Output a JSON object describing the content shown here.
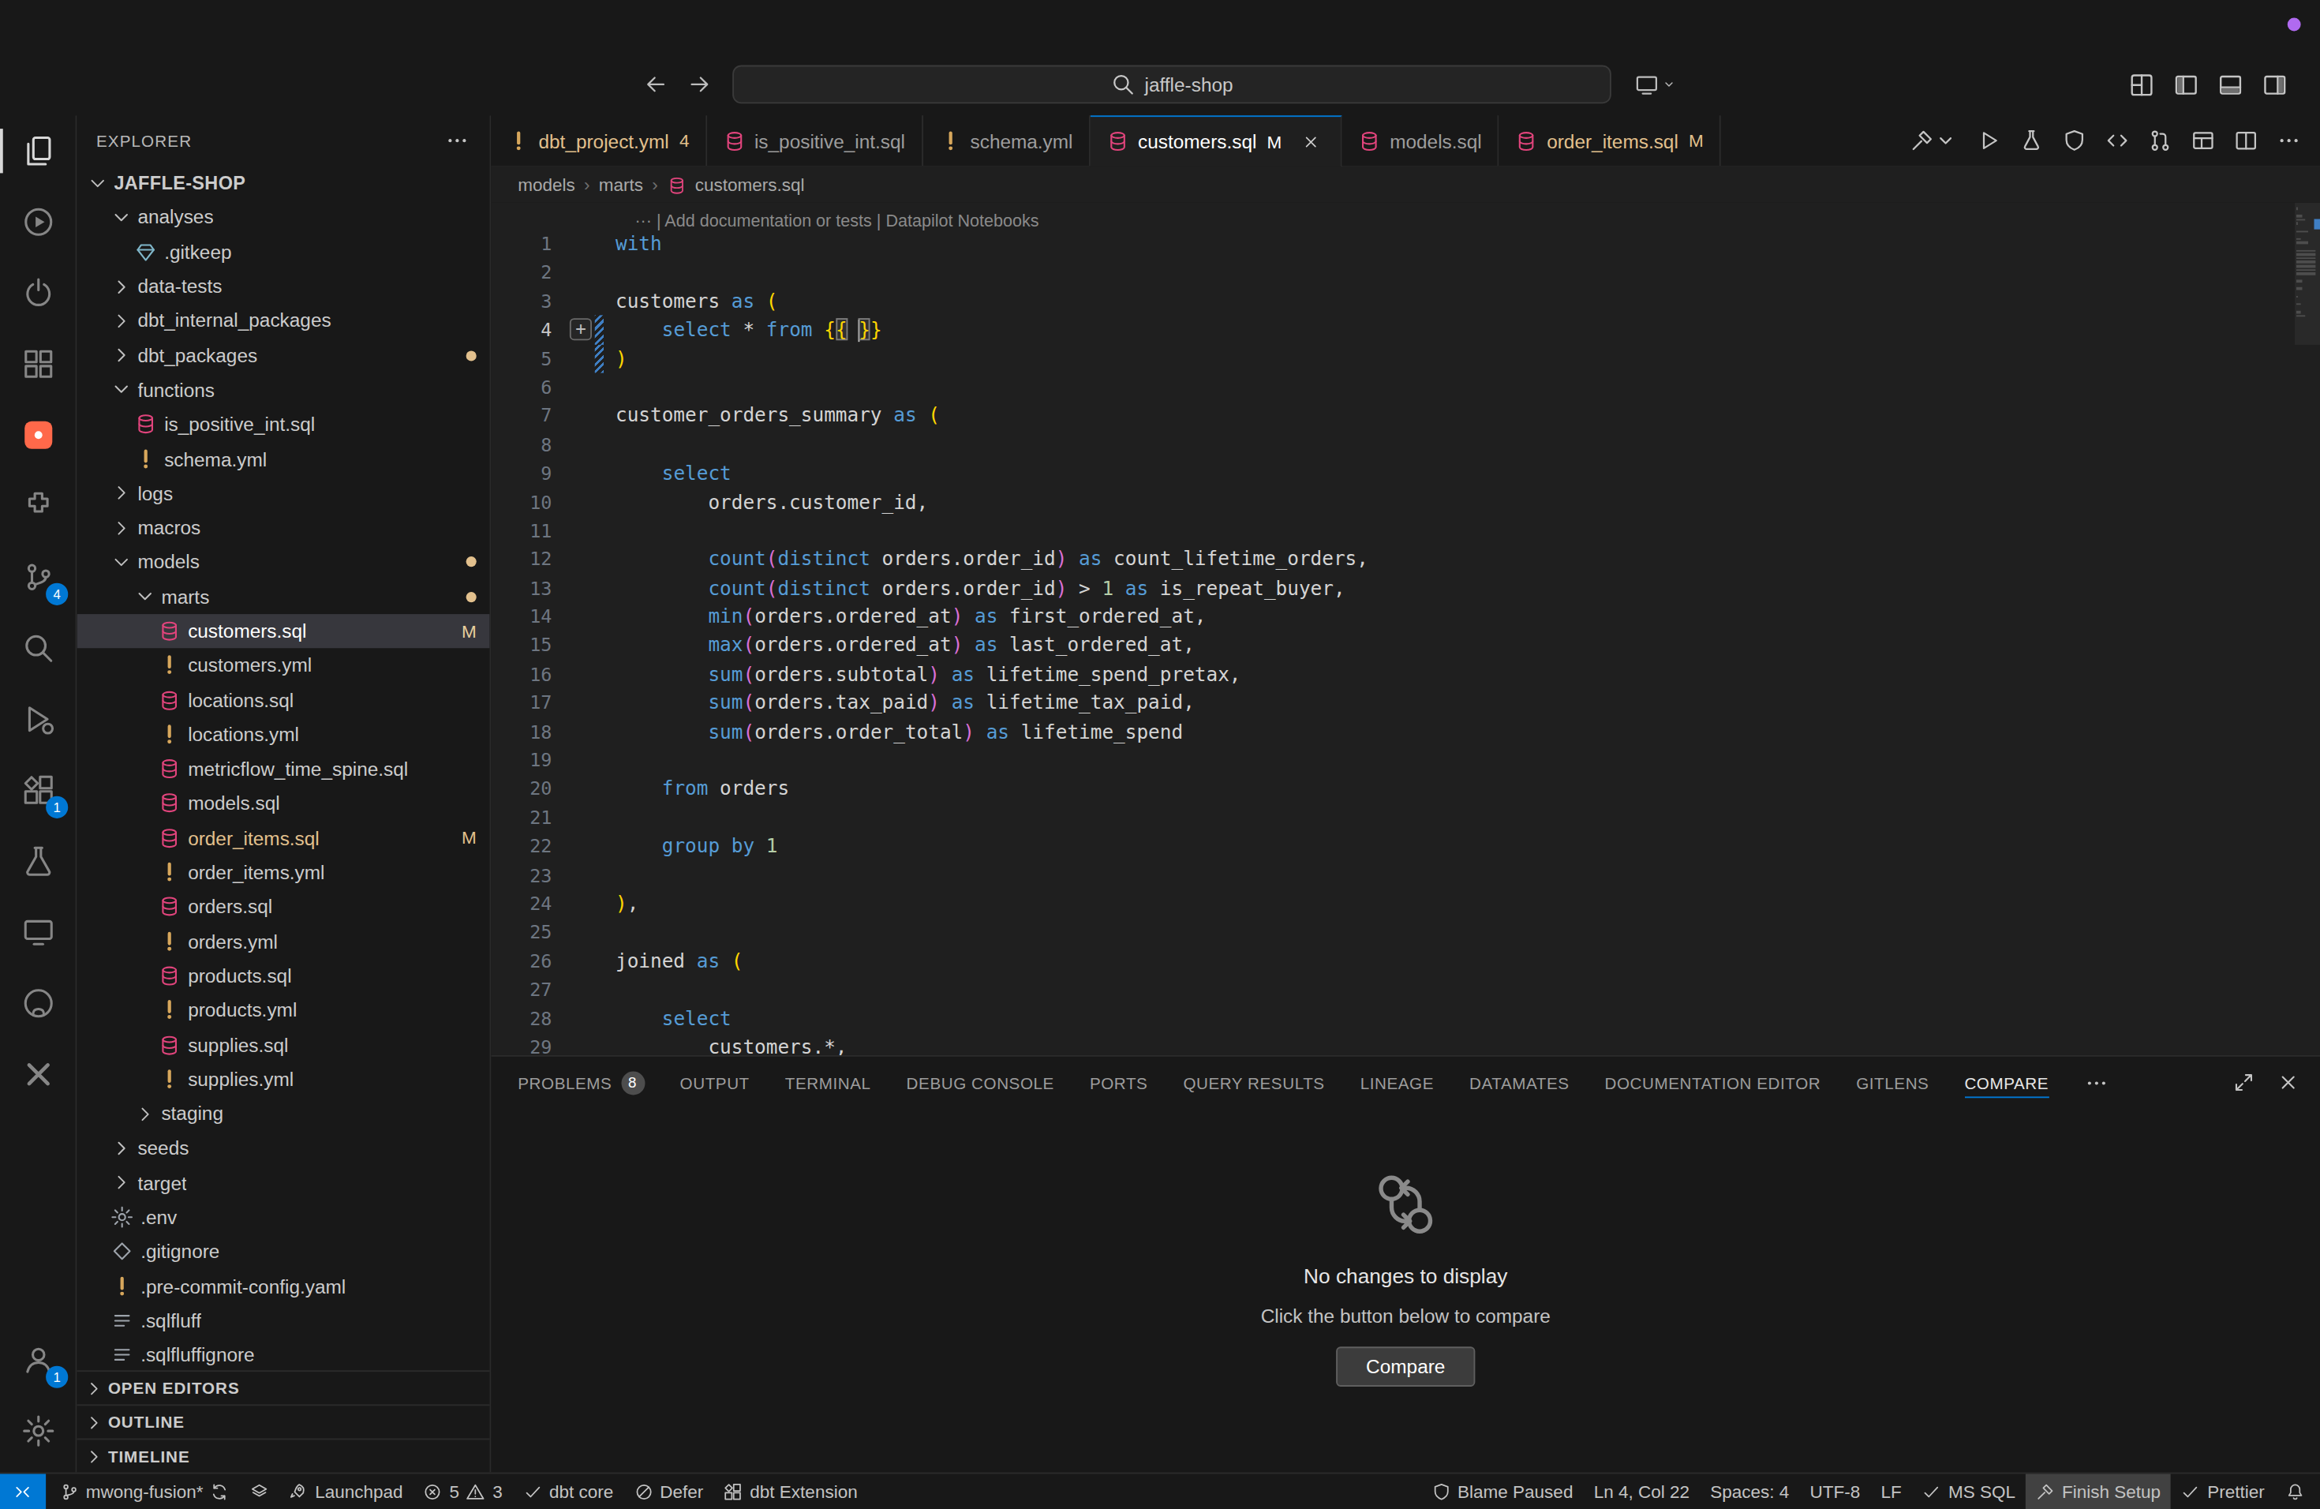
{
  "colors": {
    "accent": "#0078d4",
    "modified": "#e2c08d",
    "dbt_orange": "#ff694a",
    "sql_icon_pink": "#e1447c",
    "yaml_icon_yellow": "#d7a75c",
    "keyword_blue": "#569cd6",
    "bracket_gold": "#ffd700",
    "bracket_pink": "#da70d6",
    "title_indicator": "#b06af0"
  },
  "title_bar": {
    "search_text": "jaffle-shop",
    "nav": [
      {
        "name": "navigate-back",
        "icon": "arrow-left"
      },
      {
        "name": "navigate-forward",
        "icon": "arrow-right"
      }
    ],
    "cast": {
      "name": "screencast-control",
      "icon": "cast",
      "chevron": true
    },
    "actions": [
      {
        "name": "customize-layout",
        "icon": "layout-grid"
      },
      {
        "name": "toggle-primary-sidebar",
        "icon": "layout-left"
      },
      {
        "name": "toggle-panel",
        "icon": "layout-bottom"
      },
      {
        "name": "toggle-secondary-sidebar",
        "icon": "layout-right"
      }
    ]
  },
  "activity_bar": {
    "top": [
      {
        "name": "explorer",
        "icon": "files",
        "active": true
      },
      {
        "name": "run-sessions",
        "icon": "play-circle"
      },
      {
        "name": "power-tools",
        "icon": "power-circle"
      },
      {
        "name": "components",
        "icon": "blocks"
      },
      {
        "name": "dbt-power-user",
        "icon": "dbt"
      },
      {
        "name": "puzzle-extension",
        "icon": "puzzle"
      },
      {
        "name": "source-control",
        "icon": "source-control",
        "badge": "4"
      },
      {
        "name": "search",
        "icon": "search"
      },
      {
        "name": "run-and-debug",
        "icon": "debug"
      },
      {
        "name": "extensions",
        "icon": "extensions",
        "badge": "1"
      },
      {
        "name": "testing",
        "icon": "beaker"
      },
      {
        "name": "remote-explorer",
        "icon": "monitor"
      },
      {
        "name": "github",
        "icon": "github"
      },
      {
        "name": "close-tools",
        "icon": "x-tool"
      }
    ],
    "bottom": [
      {
        "name": "accounts",
        "icon": "account",
        "badge": "1"
      },
      {
        "name": "settings",
        "icon": "gear"
      }
    ]
  },
  "sidebar": {
    "title": "EXPLORER",
    "tree": [
      {
        "label": "JAFFLE-SHOP",
        "depth": 0,
        "chevron": "down",
        "root": true
      },
      {
        "label": "analyses",
        "depth": 1,
        "chevron": "down"
      },
      {
        "label": ".gitkeep",
        "depth": 2,
        "icon": "gem"
      },
      {
        "label": "data-tests",
        "depth": 1,
        "chevron": "right"
      },
      {
        "label": "dbt_internal_packages",
        "depth": 1,
        "chevron": "right"
      },
      {
        "label": "dbt_packages",
        "depth": 1,
        "chevron": "right",
        "dot": true
      },
      {
        "label": "functions",
        "depth": 1,
        "chevron": "down"
      },
      {
        "label": "is_positive_int.sql",
        "depth": 2,
        "icon": "sql"
      },
      {
        "label": "schema.yml",
        "depth": 2,
        "icon": "yaml"
      },
      {
        "label": "logs",
        "depth": 1,
        "chevron": "right"
      },
      {
        "label": "macros",
        "depth": 1,
        "chevron": "right"
      },
      {
        "label": "models",
        "depth": 1,
        "chevron": "down",
        "dot": true
      },
      {
        "label": "marts",
        "depth": 2,
        "chevron": "down",
        "dot": true
      },
      {
        "label": "customers.sql",
        "depth": 3,
        "icon": "sql",
        "badge": "M",
        "selected": true
      },
      {
        "label": "customers.yml",
        "depth": 3,
        "icon": "yaml"
      },
      {
        "label": "locations.sql",
        "depth": 3,
        "icon": "sql"
      },
      {
        "label": "locations.yml",
        "depth": 3,
        "icon": "yaml"
      },
      {
        "label": "metricflow_time_spine.sql",
        "depth": 3,
        "icon": "sql"
      },
      {
        "label": "models.sql",
        "depth": 3,
        "icon": "sql"
      },
      {
        "label": "order_items.sql",
        "depth": 3,
        "icon": "sql",
        "badge": "M",
        "modified": true
      },
      {
        "label": "order_items.yml",
        "depth": 3,
        "icon": "yaml"
      },
      {
        "label": "orders.sql",
        "depth": 3,
        "icon": "sql"
      },
      {
        "label": "orders.yml",
        "depth": 3,
        "icon": "yaml"
      },
      {
        "label": "products.sql",
        "depth": 3,
        "icon": "sql"
      },
      {
        "label": "products.yml",
        "depth": 3,
        "icon": "yaml"
      },
      {
        "label": "supplies.sql",
        "depth": 3,
        "icon": "sql"
      },
      {
        "label": "supplies.yml",
        "depth": 3,
        "icon": "yaml"
      },
      {
        "label": "staging",
        "depth": 2,
        "chevron": "right"
      },
      {
        "label": "seeds",
        "depth": 1,
        "chevron": "right"
      },
      {
        "label": "target",
        "depth": 1,
        "chevron": "right"
      },
      {
        "label": ".env",
        "depth": 1,
        "icon": "gear-file"
      },
      {
        "label": ".gitignore",
        "depth": 1,
        "icon": "diamond-file"
      },
      {
        "label": ".pre-commit-config.yaml",
        "depth": 1,
        "icon": "yaml"
      },
      {
        "label": ".sqlfluff",
        "depth": 1,
        "icon": "lines-file"
      },
      {
        "label": ".sqlfluffignore",
        "depth": 1,
        "icon": "lines-file"
      }
    ],
    "sections": [
      "OPEN EDITORS",
      "OUTLINE",
      "TIMELINE"
    ]
  },
  "editor": {
    "tabs": [
      {
        "label": "dbt_project.yml",
        "icon": "yaml",
        "badge": "4",
        "color": "#e2c08d"
      },
      {
        "label": "is_positive_int.sql",
        "icon": "sql"
      },
      {
        "label": "schema.yml",
        "icon": "yaml"
      },
      {
        "label": "customers.sql",
        "icon": "sql",
        "suffix": "M",
        "active": true
      },
      {
        "label": "models.sql",
        "icon": "sql"
      },
      {
        "label": "order_items.sql",
        "icon": "sql",
        "suffix": "M",
        "color": "#e2c08d"
      }
    ],
    "actions": [
      {
        "name": "dbt-build",
        "icon": "hammer",
        "chevron": true
      },
      {
        "name": "run-file",
        "icon": "play-outline"
      },
      {
        "name": "run-tests",
        "icon": "flask"
      },
      {
        "name": "security-scan",
        "icon": "shield-a"
      },
      {
        "name": "compiled-code",
        "icon": "code"
      },
      {
        "name": "git-pull-request",
        "icon": "pr"
      },
      {
        "name": "query-results-grid",
        "icon": "table"
      },
      {
        "name": "split-editor",
        "icon": "split"
      },
      {
        "name": "more-actions",
        "icon": "ellipsis"
      }
    ],
    "breadcrumb": [
      "models",
      "marts",
      "customers.sql"
    ],
    "codelens": "··· | Add documentation or tests | Datapilot Notebooks",
    "cursor": {
      "line": 4,
      "col": 22
    },
    "lines": [
      {
        "n": 1,
        "tokens": [
          [
            "k",
            "with"
          ]
        ]
      },
      {
        "n": 2,
        "tokens": []
      },
      {
        "n": 3,
        "tokens": [
          [
            "t",
            "customers "
          ],
          [
            "k",
            "as"
          ],
          [
            "t",
            " "
          ],
          [
            "p1",
            "("
          ]
        ]
      },
      {
        "n": 4,
        "active": true,
        "changed": true,
        "plus": true,
        "tokens": [
          [
            "t",
            "    "
          ],
          [
            "k",
            "select"
          ],
          [
            "t",
            " * "
          ],
          [
            "k",
            "from"
          ],
          [
            "t",
            " "
          ],
          [
            "p1",
            "{"
          ],
          [
            "p2m",
            "{"
          ],
          [
            "t",
            " "
          ],
          [
            "cursor",
            ""
          ],
          [
            "p2m",
            "}"
          ],
          [
            "p1",
            "}"
          ]
        ]
      },
      {
        "n": 5,
        "changed": true,
        "tokens": [
          [
            "p1",
            ")"
          ]
        ]
      },
      {
        "n": 6,
        "tokens": []
      },
      {
        "n": 7,
        "tokens": [
          [
            "t",
            "customer_orders_summary "
          ],
          [
            "k",
            "as"
          ],
          [
            "t",
            " "
          ],
          [
            "p1",
            "("
          ]
        ]
      },
      {
        "n": 8,
        "tokens": []
      },
      {
        "n": 9,
        "tokens": [
          [
            "t",
            "    "
          ],
          [
            "k",
            "select"
          ]
        ]
      },
      {
        "n": 10,
        "tokens": [
          [
            "t",
            "        orders.customer_id,"
          ]
        ]
      },
      {
        "n": 11,
        "tokens": []
      },
      {
        "n": 12,
        "tokens": [
          [
            "t",
            "        "
          ],
          [
            "k",
            "count"
          ],
          [
            "p2",
            "("
          ],
          [
            "k",
            "distinct"
          ],
          [
            "t",
            " orders.order_id"
          ],
          [
            "p2",
            ")"
          ],
          [
            "t",
            " "
          ],
          [
            "k",
            "as"
          ],
          [
            "t",
            " count_lifetime_orders,"
          ]
        ]
      },
      {
        "n": 13,
        "tokens": [
          [
            "t",
            "        "
          ],
          [
            "k",
            "count"
          ],
          [
            "p2",
            "("
          ],
          [
            "k",
            "distinct"
          ],
          [
            "t",
            " orders.order_id"
          ],
          [
            "p2",
            ")"
          ],
          [
            "t",
            " > "
          ],
          [
            "n",
            "1"
          ],
          [
            "t",
            " "
          ],
          [
            "k",
            "as"
          ],
          [
            "t",
            " is_repeat_buyer,"
          ]
        ]
      },
      {
        "n": 14,
        "tokens": [
          [
            "t",
            "        "
          ],
          [
            "k",
            "min"
          ],
          [
            "p2",
            "("
          ],
          [
            "t",
            "orders.ordered_at"
          ],
          [
            "p2",
            ")"
          ],
          [
            "t",
            " "
          ],
          [
            "k",
            "as"
          ],
          [
            "t",
            " first_ordered_at,"
          ]
        ]
      },
      {
        "n": 15,
        "tokens": [
          [
            "t",
            "        "
          ],
          [
            "k",
            "max"
          ],
          [
            "p2",
            "("
          ],
          [
            "t",
            "orders.ordered_at"
          ],
          [
            "p2",
            ")"
          ],
          [
            "t",
            " "
          ],
          [
            "k",
            "as"
          ],
          [
            "t",
            " last_ordered_at,"
          ]
        ]
      },
      {
        "n": 16,
        "tokens": [
          [
            "t",
            "        "
          ],
          [
            "k",
            "sum"
          ],
          [
            "p2",
            "("
          ],
          [
            "t",
            "orders.subtotal"
          ],
          [
            "p2",
            ")"
          ],
          [
            "t",
            " "
          ],
          [
            "k",
            "as"
          ],
          [
            "t",
            " lifetime_spend_pretax,"
          ]
        ]
      },
      {
        "n": 17,
        "tokens": [
          [
            "t",
            "        "
          ],
          [
            "k",
            "sum"
          ],
          [
            "p2",
            "("
          ],
          [
            "t",
            "orders.tax_paid"
          ],
          [
            "p2",
            ")"
          ],
          [
            "t",
            " "
          ],
          [
            "k",
            "as"
          ],
          [
            "t",
            " lifetime_tax_paid,"
          ]
        ]
      },
      {
        "n": 18,
        "tokens": [
          [
            "t",
            "        "
          ],
          [
            "k",
            "sum"
          ],
          [
            "p2",
            "("
          ],
          [
            "t",
            "orders.order_total"
          ],
          [
            "p2",
            ")"
          ],
          [
            "t",
            " "
          ],
          [
            "k",
            "as"
          ],
          [
            "t",
            " lifetime_spend"
          ]
        ]
      },
      {
        "n": 19,
        "tokens": []
      },
      {
        "n": 20,
        "tokens": [
          [
            "t",
            "    "
          ],
          [
            "k",
            "from"
          ],
          [
            "t",
            " orders"
          ]
        ]
      },
      {
        "n": 21,
        "tokens": []
      },
      {
        "n": 22,
        "tokens": [
          [
            "t",
            "    "
          ],
          [
            "k",
            "group by"
          ],
          [
            "t",
            " "
          ],
          [
            "n",
            "1"
          ]
        ]
      },
      {
        "n": 23,
        "tokens": []
      },
      {
        "n": 24,
        "tokens": [
          [
            "p1",
            ")"
          ],
          [
            "t",
            ","
          ]
        ]
      },
      {
        "n": 25,
        "tokens": []
      },
      {
        "n": 26,
        "tokens": [
          [
            "t",
            "joined "
          ],
          [
            "k",
            "as"
          ],
          [
            "t",
            " "
          ],
          [
            "p1",
            "("
          ]
        ]
      },
      {
        "n": 27,
        "tokens": []
      },
      {
        "n": 28,
        "tokens": [
          [
            "t",
            "    "
          ],
          [
            "k",
            "select"
          ]
        ]
      },
      {
        "n": 29,
        "tokens": [
          [
            "t",
            "        customers.*,"
          ]
        ]
      }
    ]
  },
  "panel": {
    "tabs": [
      {
        "label": "PROBLEMS",
        "badge": "8"
      },
      {
        "label": "OUTPUT"
      },
      {
        "label": "TERMINAL"
      },
      {
        "label": "DEBUG CONSOLE"
      },
      {
        "label": "PORTS"
      },
      {
        "label": "QUERY RESULTS"
      },
      {
        "label": "LINEAGE"
      },
      {
        "label": "DATAMATES"
      },
      {
        "label": "DOCUMENTATION EDITOR"
      },
      {
        "label": "GITLENS"
      },
      {
        "label": "COMPARE",
        "active": true
      }
    ],
    "actions": [
      {
        "name": "maximize-panel",
        "icon": "expand"
      },
      {
        "name": "close-panel",
        "icon": "close"
      }
    ],
    "empty_title": "No changes to display",
    "empty_subtitle": "Click the button below to compare",
    "button_label": "Compare"
  },
  "status_bar": {
    "left": [
      {
        "name": "remote",
        "icon": "remote",
        "accent": true
      },
      {
        "name": "git-branch",
        "icon": "branch",
        "label": "mwong-fusion*",
        "icon2": "sync"
      },
      {
        "name": "compare-working",
        "icon": "layers"
      },
      {
        "name": "launchpad",
        "icon": "rocket",
        "label": "Launchpad"
      },
      {
        "name": "problems",
        "icon": "error",
        "label": "5",
        "icon2": "warning",
        "label2": "3"
      },
      {
        "name": "dbt-core",
        "icon": "check",
        "label": "dbt core"
      },
      {
        "name": "defer",
        "icon": "circle-slash",
        "label": "Defer"
      },
      {
        "name": "dbt-extension",
        "icon": "extension-sm",
        "label": "dbt Extension"
      }
    ],
    "right": [
      {
        "name": "gitlens-blame",
        "icon": "shield",
        "label": "Blame Paused"
      },
      {
        "name": "cursor-position",
        "label": "Ln 4, Col 22"
      },
      {
        "name": "indentation",
        "label": "Spaces: 4"
      },
      {
        "name": "encoding",
        "label": "UTF-8"
      },
      {
        "name": "eol",
        "label": "LF"
      },
      {
        "name": "language-mode",
        "icon": "check",
        "label": "MS SQL"
      },
      {
        "name": "finish-setup",
        "icon": "hammer",
        "label": "Finish Setup",
        "highlight": true
      },
      {
        "name": "prettier",
        "icon": "check",
        "label": "Prettier"
      },
      {
        "name": "notifications",
        "icon": "bell"
      }
    ]
  }
}
